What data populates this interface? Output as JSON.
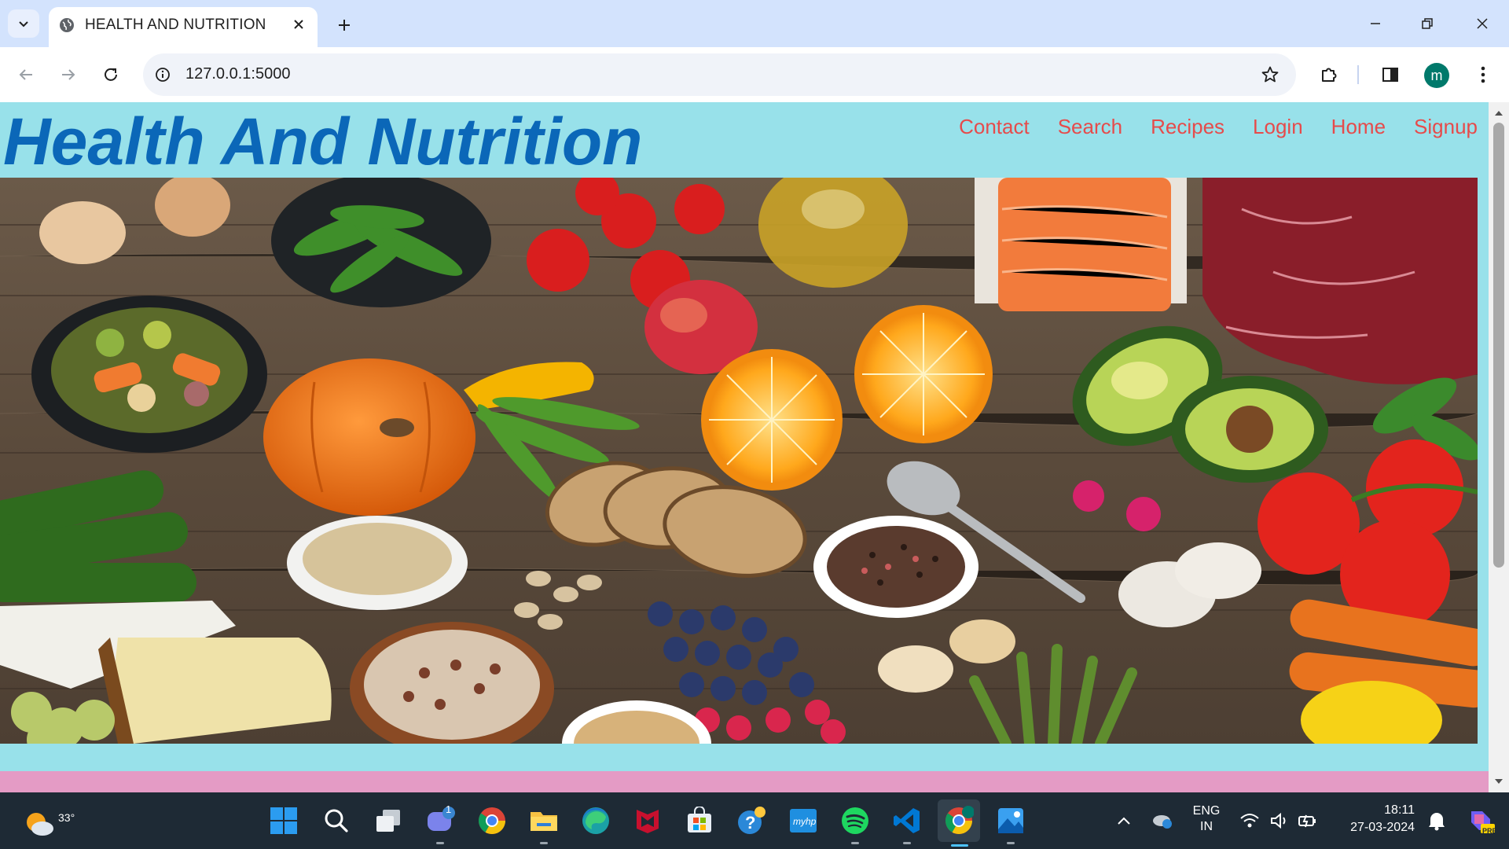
{
  "browser": {
    "tab_title": "HEALTH AND NUTRITION",
    "url": "127.0.0.1:5000",
    "profile_initial": "m"
  },
  "page": {
    "site_title": "Health And Nutrition",
    "nav": [
      "Contact",
      "Search",
      "Recipes",
      "Login",
      "Home",
      "Signup"
    ],
    "hero_image": "Top-down photo of healthy foods on a rustic wooden table",
    "colors": {
      "background": "#98e1ea",
      "title": "#0b67b8",
      "nav_link": "#e64b4b",
      "footer_bar": "#e49bc5"
    }
  },
  "taskbar": {
    "weather_temp": "33°",
    "chat_badge": "1",
    "apps": [
      "start",
      "search",
      "task-view",
      "teams-chat",
      "chrome",
      "file-explorer",
      "edge",
      "mcafee",
      "microsoft-store",
      "get-help",
      "myhp",
      "spotify",
      "vscode",
      "chrome-profile",
      "photos"
    ],
    "lang_top": "ENG",
    "lang_bottom": "IN",
    "time": "18:11",
    "date": "27-03-2024",
    "copilot_badge": "PRE"
  }
}
